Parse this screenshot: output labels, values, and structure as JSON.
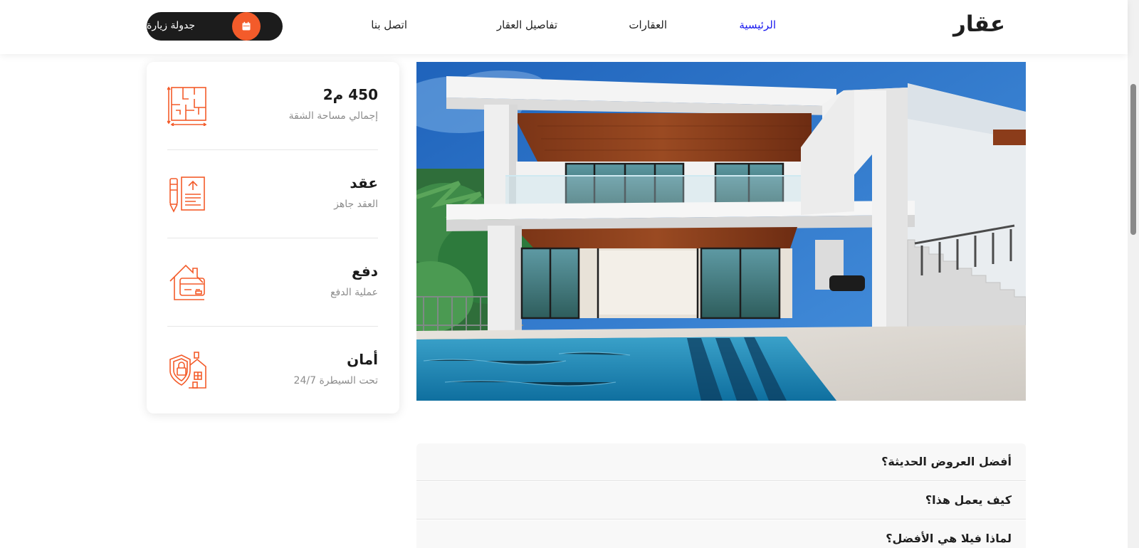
{
  "header": {
    "logo": "عقار",
    "nav": [
      {
        "label": "الرئيسية",
        "active": true
      },
      {
        "label": "العقارات",
        "active": false
      },
      {
        "label": "تفاصيل العقار",
        "active": false
      },
      {
        "label": "اتصل بنا",
        "active": false
      }
    ],
    "cta_label": "جدولة زيارة",
    "cta_icon": "calendar-icon"
  },
  "colors": {
    "accent": "#f35b2a",
    "nav_active": "#1717ef",
    "dark": "#1c1c1c",
    "muted_text": "#8c8c8c"
  },
  "features": [
    {
      "title": "450 م2",
      "subtitle": "إجمالي مساحة الشقة",
      "icon": "floor-plan-icon"
    },
    {
      "title": "عقد",
      "subtitle": "العقد جاهز",
      "icon": "contract-icon"
    },
    {
      "title": "دفع",
      "subtitle": "عملية الدفع",
      "icon": "payment-card-house-icon"
    },
    {
      "title": "أمان",
      "subtitle": "تحت السيطرة 24/7",
      "icon": "security-shield-icon"
    }
  ],
  "hero": {
    "image": "modern-villa-with-pool-photo"
  },
  "faq": [
    {
      "question": "أفضل العروض الحديثة؟"
    },
    {
      "question": "كيف يعمل هذا؟"
    },
    {
      "question": "لماذا فيلا هي الأفضل؟"
    }
  ]
}
